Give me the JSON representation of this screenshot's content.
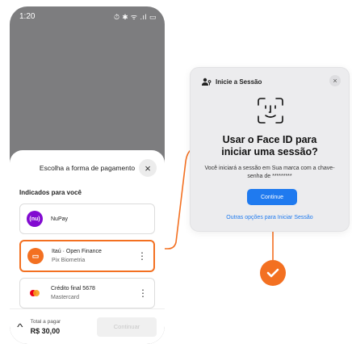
{
  "status_bar": {
    "time": "1:20",
    "icons": "⏱ ✱ ᯤ .ıl ▭"
  },
  "sheet": {
    "title": "Escolha a forma de pagamento",
    "close_icon": "×",
    "section_label": "Indicados para você",
    "options": [
      {
        "icon_text": "(nu)",
        "title": "NuPay",
        "subtitle": "",
        "icon_color": "#820ad1",
        "icon": "nubank-logo-icon"
      },
      {
        "icon_text": "▭",
        "title": "Itaú · Open Finance",
        "subtitle": "Pix Biometria",
        "icon_color": "#f37021",
        "icon": "itau-logo-icon",
        "selected": true
      },
      {
        "icon_text": "",
        "title": "Crédito final 5678",
        "subtitle": "Mastercard",
        "icon_color": "#ffffff",
        "icon": "mastercard-icon"
      }
    ],
    "more_icon": "⋮",
    "footer": {
      "chevron": "^",
      "total_label": "Total a pagar",
      "total_value": "R$ 30,00",
      "continue_label": "Continuar"
    }
  },
  "faceid_card": {
    "header": "Inicie a Sessão",
    "close_icon": "×",
    "title": "Usar o Face ID para iniciar uma sessão?",
    "body": "Você iniciará a sessão em Sua marca com a chave-senha de *********",
    "button": "Continue",
    "link": "Outras opções para Iniciar Sessão"
  },
  "colors": {
    "accent_orange": "#f37021",
    "accent_blue": "#1f7aef",
    "nubank_purple": "#820ad1"
  }
}
